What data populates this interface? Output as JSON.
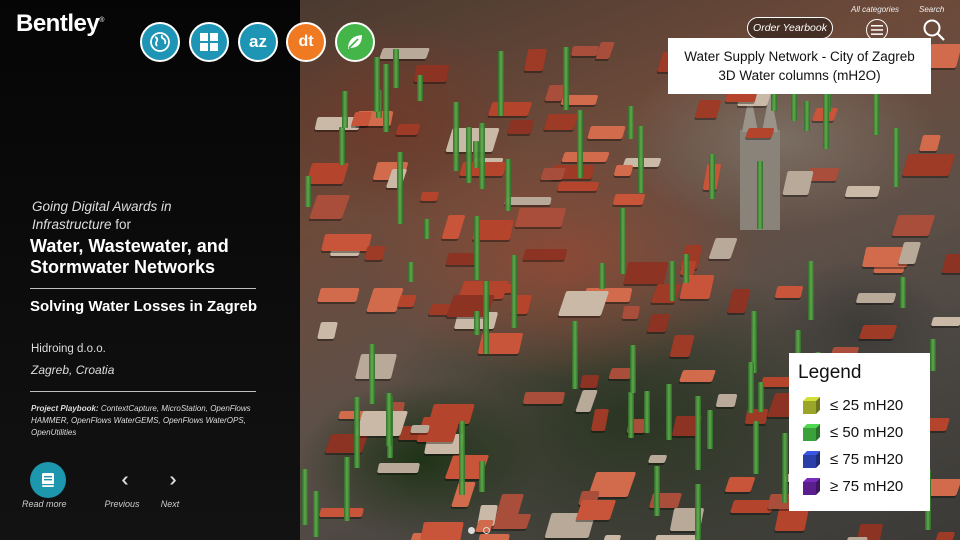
{
  "brand": {
    "logo_text": "Bentley"
  },
  "category_icons": [
    {
      "icon": "globe-icon",
      "color": "#1e95b5"
    },
    {
      "icon": "grid-icon",
      "color": "#1e95b5"
    },
    {
      "icon": "az-icon",
      "color": "#1e95b5",
      "text": "az"
    },
    {
      "icon": "dt-icon",
      "color": "#f07a22",
      "text": "dt"
    },
    {
      "icon": "leaf-icon",
      "color": "#43b549"
    }
  ],
  "header": {
    "order_yearbook": "Order Yearbook",
    "all_categories": "All categories",
    "search": "Search"
  },
  "panel": {
    "intro_line1": "Going Digital Awards in",
    "intro_line2": "Infrastructure",
    "intro_for": "for",
    "category_title": "Water, Wastewater, and Stormwater Networks",
    "project_title": "Solving Water Losses in Zagreb",
    "company": "Hidroing d.o.o.",
    "location": "Zagreb, Croatia",
    "playbook_label": "Project Playbook:",
    "playbook_text": "ContextCapture, MicroStation, OpenFlows HAMMER, OpenFlows WaterGEMS, OpenFlows WaterOPS, OpenUtilities",
    "read_more": "Read more",
    "previous": "Previous",
    "next": "Next"
  },
  "map": {
    "title_line1": "Water Supply Network - City of Zagreb",
    "title_line2": "3D Water columns (mH2O)",
    "legend_title": "Legend",
    "legend": [
      {
        "label": "≤ 25 mH20",
        "color": "#9aa62a"
      },
      {
        "label": "≤ 50 mH20",
        "color": "#3ba13b"
      },
      {
        "label": "≤ 75 mH20",
        "color": "#2b3fa8"
      },
      {
        "label": "≥ 75 mH20",
        "color": "#5a1f8c"
      }
    ]
  },
  "carousel": {
    "pages": 2,
    "active": 1
  }
}
